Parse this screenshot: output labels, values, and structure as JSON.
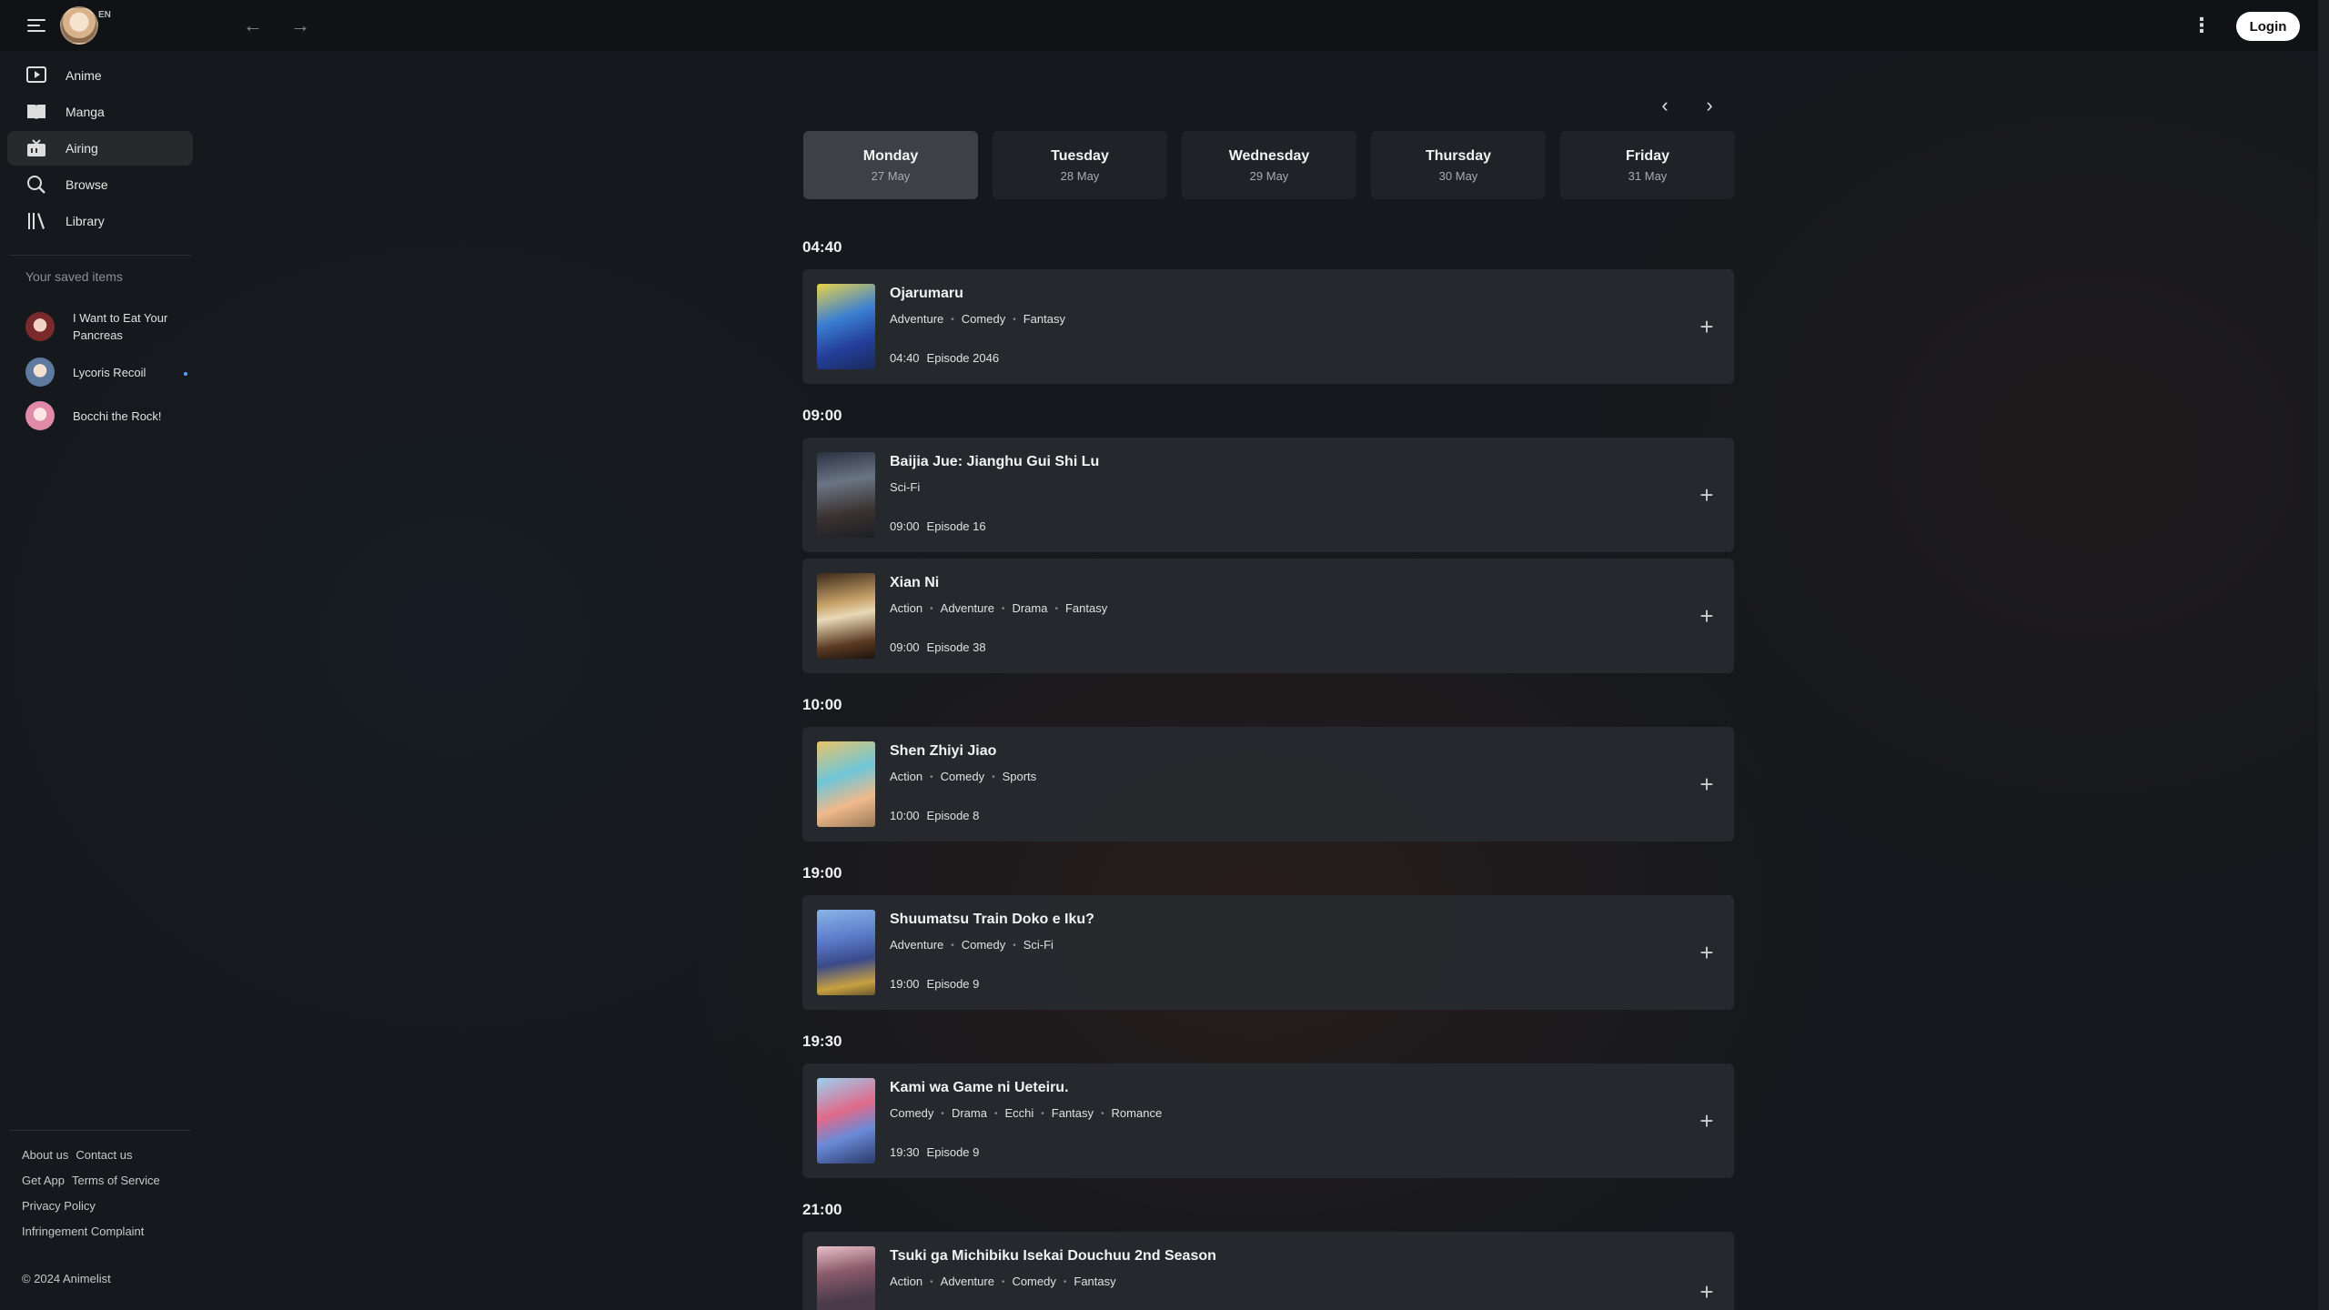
{
  "header": {
    "lang": "EN",
    "login_label": "Login",
    "icons": [
      "menu-icon",
      "back-arrow-icon",
      "forward-arrow-icon",
      "kebab-icon"
    ]
  },
  "sidebar": {
    "nav": [
      {
        "label": "Anime",
        "icon": "play-icon"
      },
      {
        "label": "Manga",
        "icon": "book-icon"
      },
      {
        "label": "Airing",
        "icon": "tv-icon",
        "active": true
      },
      {
        "label": "Browse",
        "icon": "search-icon"
      },
      {
        "label": "Library",
        "icon": "library-icon"
      }
    ],
    "saved_title": "Your saved items",
    "saved": [
      {
        "label": "I Want to Eat Your Pancreas"
      },
      {
        "label": "Lycoris Recoil"
      },
      {
        "label": "Bocchi the Rock!"
      }
    ],
    "footer": {
      "about": "About us",
      "contact": "Contact us",
      "get_app": "Get App",
      "terms": "Terms of Service",
      "privacy": "Privacy Policy",
      "infringement": "Infringement Complaint",
      "copyright": "© 2024 Animelist"
    }
  },
  "days": [
    {
      "name": "Monday",
      "date": "27 May",
      "active": true
    },
    {
      "name": "Tuesday",
      "date": "28 May"
    },
    {
      "name": "Wednesday",
      "date": "29 May"
    },
    {
      "name": "Thursday",
      "date": "30 May"
    },
    {
      "name": "Friday",
      "date": "31 May"
    }
  ],
  "schedule": {
    "t1": "04:40",
    "t2": "09:00",
    "t3": "10:00",
    "t4": "19:00",
    "t5": "19:30",
    "t6": "21:00",
    "items": [
      {
        "title": "Ojarumaru",
        "genres": [
          "Adventure",
          "Comedy",
          "Fantasy"
        ],
        "time": "04:40",
        "episode": "Episode 2046"
      },
      {
        "title": "Baijia Jue: Jianghu Gui Shi Lu",
        "genres": [
          "Sci-Fi"
        ],
        "time": "09:00",
        "episode": "Episode 16"
      },
      {
        "title": "Xian Ni",
        "genres": [
          "Action",
          "Adventure",
          "Drama",
          "Fantasy"
        ],
        "time": "09:00",
        "episode": "Episode 38"
      },
      {
        "title": "Shen Zhiyi Jiao",
        "genres": [
          "Action",
          "Comedy",
          "Sports"
        ],
        "time": "10:00",
        "episode": "Episode 8"
      },
      {
        "title": "Shuumatsu Train Doko e Iku?",
        "genres": [
          "Adventure",
          "Comedy",
          "Sci-Fi"
        ],
        "time": "19:00",
        "episode": "Episode 9"
      },
      {
        "title": "Kami wa Game ni Ueteiru.",
        "genres": [
          "Comedy",
          "Drama",
          "Ecchi",
          "Fantasy",
          "Romance"
        ],
        "time": "19:30",
        "episode": "Episode 9"
      },
      {
        "title": "Tsuki ga Michibiku Isekai Douchuu 2nd Season",
        "genres": [
          "Action",
          "Adventure",
          "Comedy",
          "Fantasy"
        ],
        "time": "",
        "episode": ""
      }
    ]
  }
}
